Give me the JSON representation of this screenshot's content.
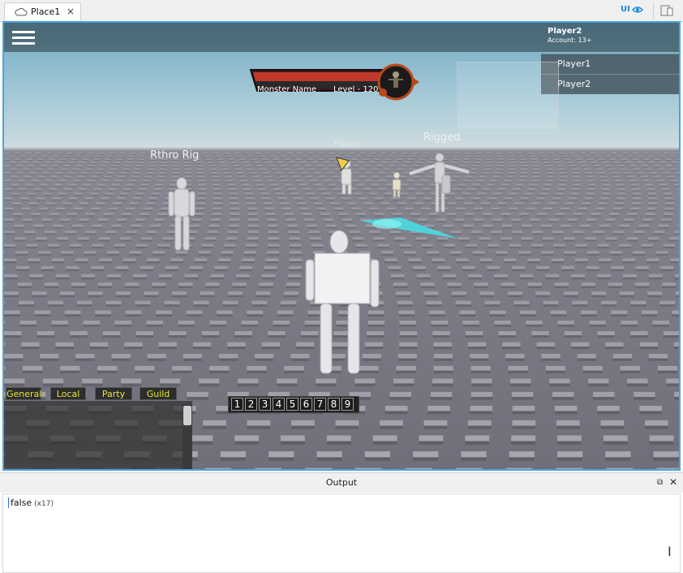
{
  "tab": {
    "title": "Place1",
    "close": "×",
    "icon": "cloud-icon"
  },
  "toolbar": {
    "ui_label": "UI",
    "ui_icon": "eye-icon",
    "device_icon": "device-emulator-icon"
  },
  "game": {
    "menu_icon": "hamburger-menu-icon",
    "player": {
      "name": "Player2",
      "account": "Account: 13+"
    },
    "player_list": [
      "Player1",
      "Player2"
    ],
    "monster": {
      "name": "Monster Name",
      "level": "Level - 120",
      "portrait_icon": "monster-portrait-icon"
    },
    "world_labels": {
      "rthro": "Rthro Rig",
      "player1": "Player1",
      "rigged": "Rigged"
    },
    "chat_tabs": [
      "General",
      "Local",
      "Party",
      "Guild"
    ],
    "hotbar": [
      "1",
      "2",
      "3",
      "4",
      "5",
      "6",
      "7",
      "8",
      "9"
    ]
  },
  "output": {
    "title": "Output",
    "float_icon": "float-window-icon",
    "close": "✕",
    "line_text": "false",
    "line_count": "(x17)"
  },
  "colors": {
    "accent": "#4aa3df",
    "chat_tab_text": "#e6e63a",
    "health_bar": "#c0392b"
  }
}
